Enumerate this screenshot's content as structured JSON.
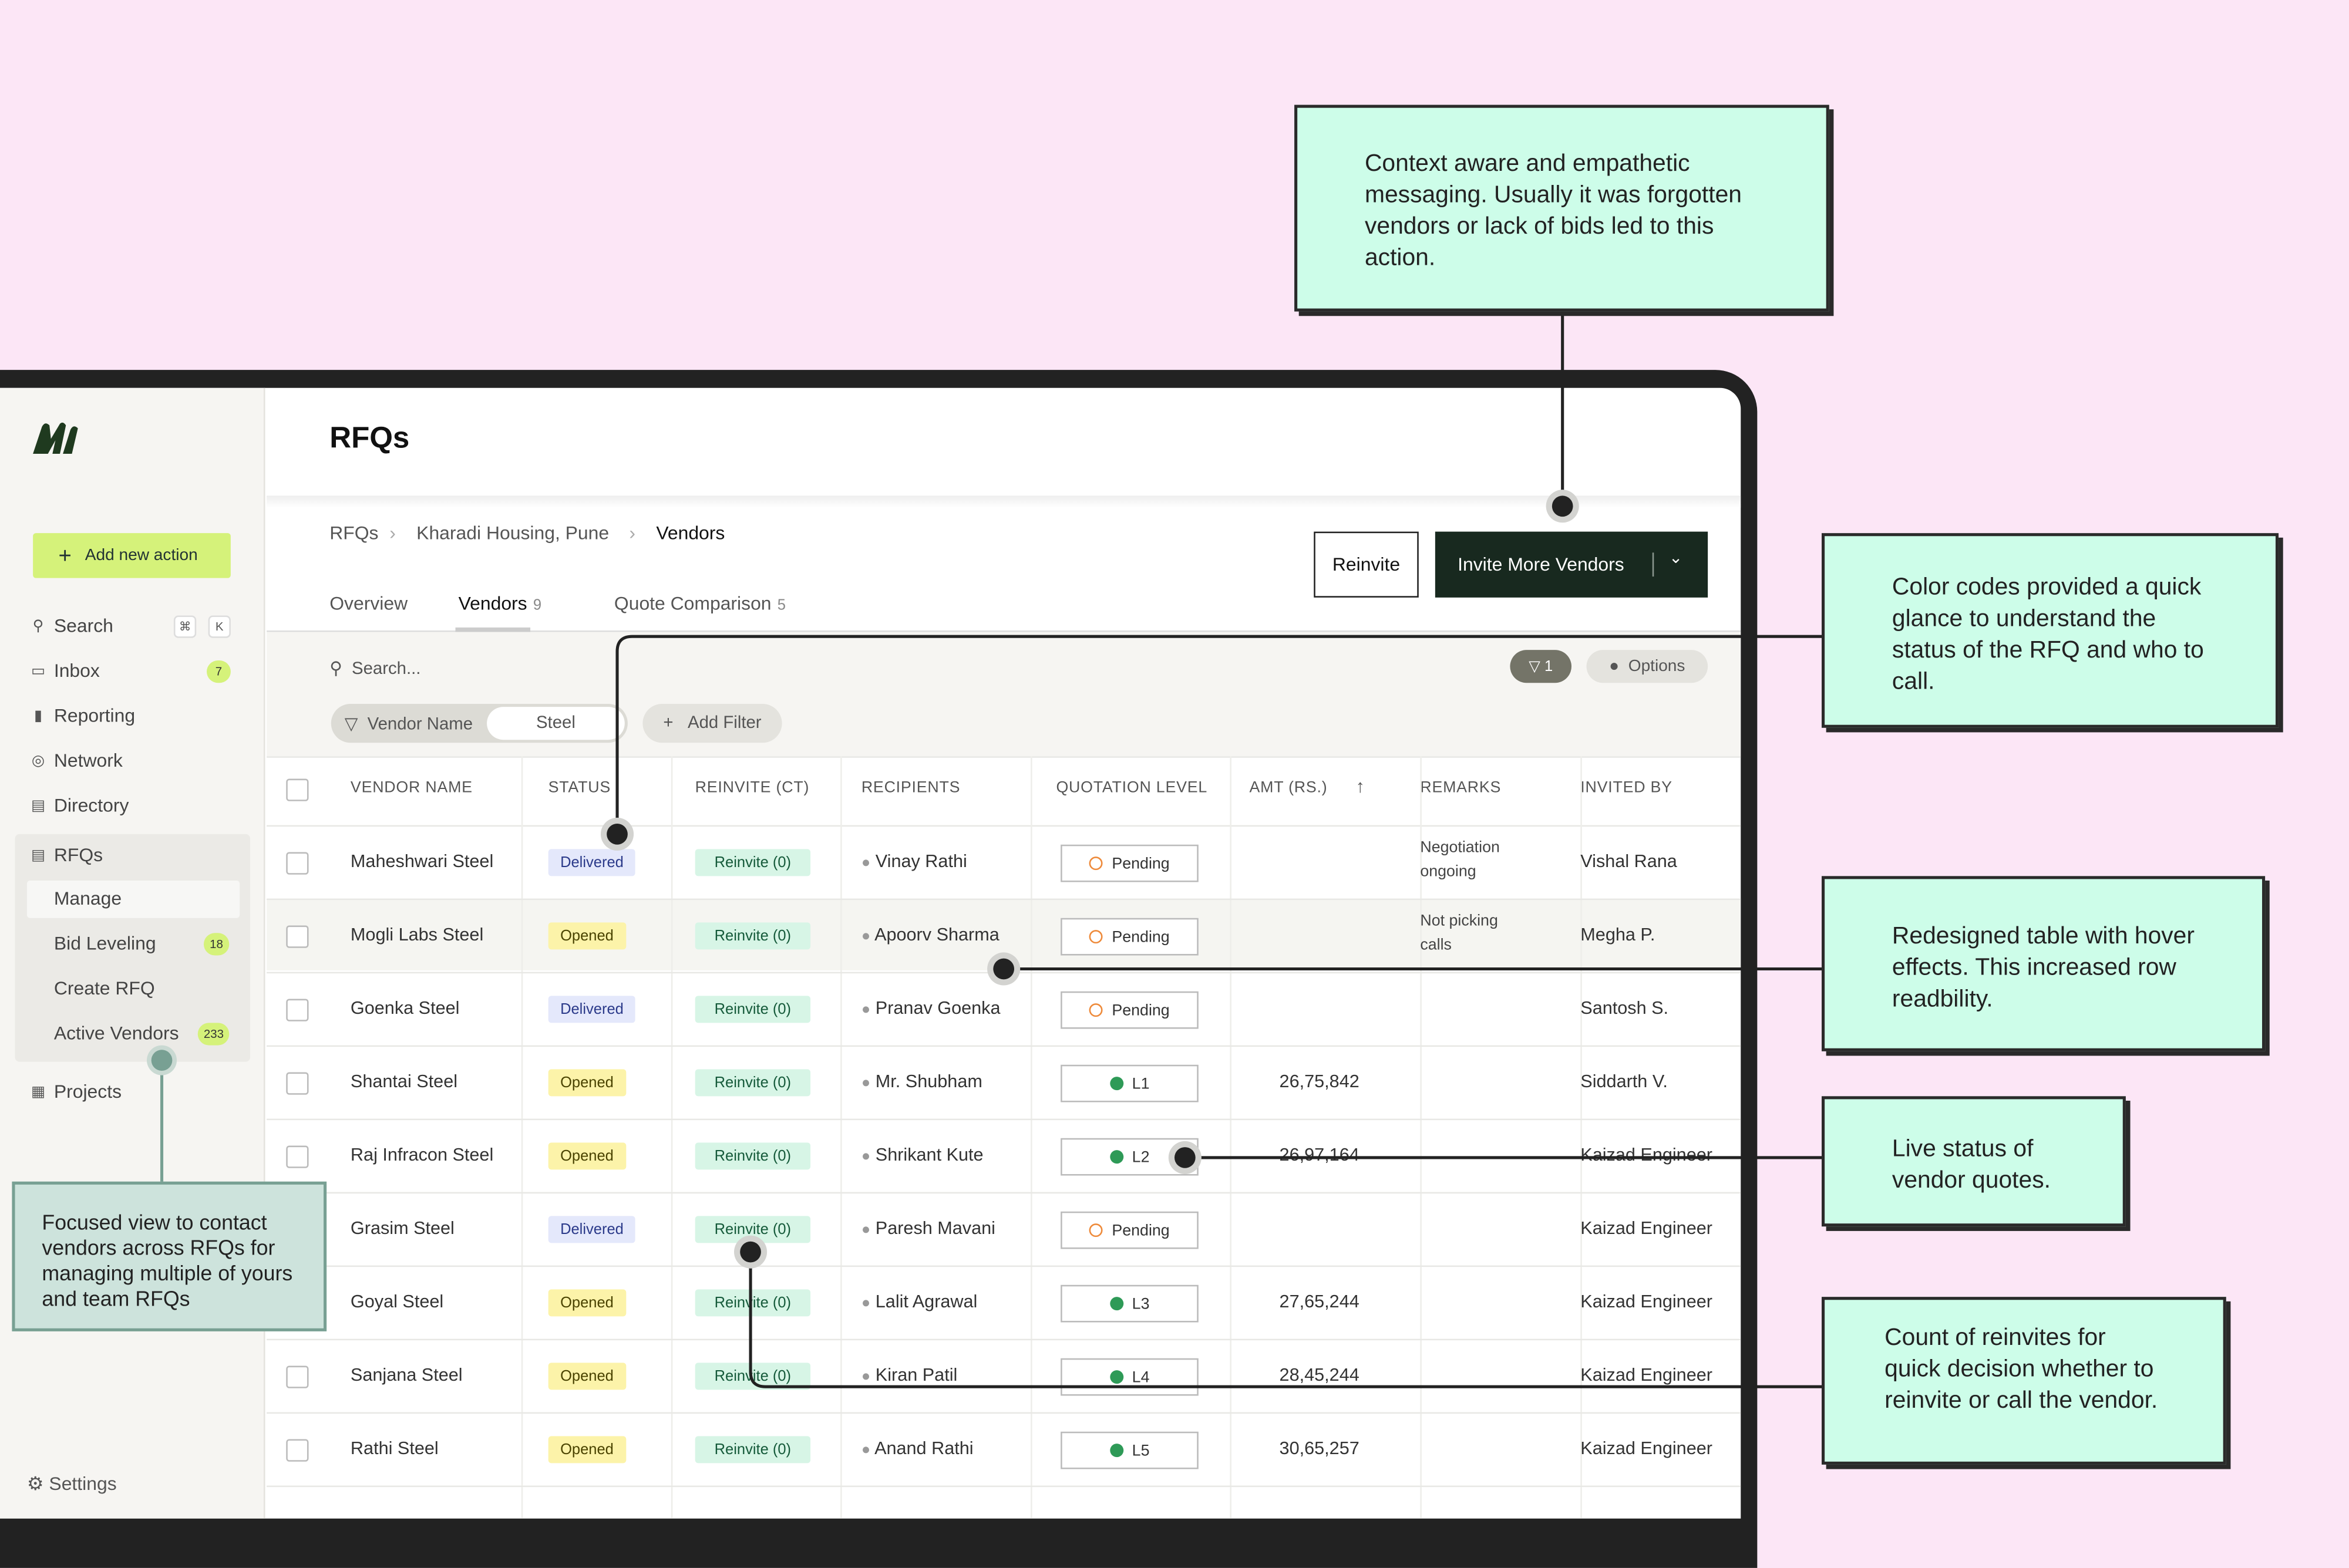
{
  "app": {
    "title": "RFQs"
  },
  "sidebar": {
    "add_action": "Add new action",
    "nav": [
      {
        "label": "Search",
        "icon": "search-icon"
      },
      {
        "label": "Inbox",
        "icon": "inbox-icon",
        "count": "7"
      },
      {
        "label": "Reporting",
        "icon": "bar-chart-icon"
      },
      {
        "label": "Network",
        "icon": "globe-icon"
      },
      {
        "label": "Directory",
        "icon": "book-icon"
      }
    ],
    "search_keys": [
      "⌘",
      "K"
    ],
    "rfqs": {
      "label": "RFQs",
      "items": [
        {
          "label": "Manage"
        },
        {
          "label": "Bid Leveling",
          "count": "18"
        },
        {
          "label": "Create RFQ"
        },
        {
          "label": "Active Vendors",
          "count": "233"
        }
      ]
    },
    "projects": "Projects",
    "settings": "Settings"
  },
  "breadcrumb": [
    "RFQs",
    "Kharadi Housing, Pune",
    "Vendors"
  ],
  "actions": {
    "reinvite": "Reinvite",
    "invite_more": "Invite More Vendors"
  },
  "tabs": [
    {
      "label": "Overview",
      "count": ""
    },
    {
      "label": "Vendors",
      "count": "9"
    },
    {
      "label": "Quote Comparison",
      "count": "5"
    }
  ],
  "toolbar": {
    "search_placeholder": "Search...",
    "filter_count": "1",
    "options": "Options",
    "filter_chip": {
      "field": "Vendor Name",
      "value": "Steel"
    },
    "add_filter": "Add Filter"
  },
  "table": {
    "columns": [
      "VENDOR NAME",
      "STATUS",
      "REINVITE (CT)",
      "RECIPIENTS",
      "QUOTATION LEVEL",
      "AMT (RS.)",
      "REMARKS",
      "INVITED BY"
    ],
    "rows": [
      {
        "vendor": "Maheshwari Steel",
        "status": "Delivered",
        "reinvite": "Reinvite (0)",
        "recipient": "Vinay Rathi",
        "quote": "Pending",
        "amount": "",
        "remarks": [
          "Negotiation",
          "ongoing"
        ],
        "invited_by": "Vishal Rana"
      },
      {
        "vendor": "Mogli Labs Steel",
        "status": "Opened",
        "reinvite": "Reinvite (0)",
        "recipient": "Apoorv Sharma",
        "quote": "Pending",
        "amount": "",
        "remarks": [
          "Not picking",
          "calls"
        ],
        "invited_by": "Megha P."
      },
      {
        "vendor": "Goenka Steel",
        "status": "Delivered",
        "reinvite": "Reinvite (0)",
        "recipient": "Pranav Goenka",
        "quote": "Pending",
        "amount": "",
        "remarks": [
          "",
          ""
        ],
        "invited_by": "Santosh S."
      },
      {
        "vendor": "Shantai Steel",
        "status": "Opened",
        "reinvite": "Reinvite (0)",
        "recipient": "Mr. Shubham",
        "quote": "L1",
        "amount": "26,75,842",
        "remarks": [
          "",
          ""
        ],
        "invited_by": "Siddarth V."
      },
      {
        "vendor": "Raj Infracon Steel",
        "status": "Opened",
        "reinvite": "Reinvite (0)",
        "recipient": "Shrikant Kute",
        "quote": "L2",
        "amount": "26,97,164",
        "remarks": [
          "",
          ""
        ],
        "invited_by": "Kaizad Engineer"
      },
      {
        "vendor": "Grasim Steel",
        "status": "Delivered",
        "reinvite": "Reinvite (0)",
        "recipient": "Paresh Mavani",
        "quote": "Pending",
        "amount": "",
        "remarks": [
          "",
          ""
        ],
        "invited_by": "Kaizad Engineer"
      },
      {
        "vendor": "Goyal Steel",
        "status": "Opened",
        "reinvite": "Reinvite (0)",
        "recipient": "Lalit Agrawal",
        "quote": "L3",
        "amount": "27,65,244",
        "remarks": [
          "",
          ""
        ],
        "invited_by": "Kaizad Engineer"
      },
      {
        "vendor": "Sanjana Steel",
        "status": "Opened",
        "reinvite": "Reinvite (0)",
        "recipient": "Kiran Patil",
        "quote": "L4",
        "amount": "28,45,244",
        "remarks": [
          "",
          ""
        ],
        "invited_by": "Kaizad Engineer"
      },
      {
        "vendor": "Rathi Steel",
        "status": "Opened",
        "reinvite": "Reinvite (0)",
        "recipient": "Anand Rathi",
        "quote": "L5",
        "amount": "30,65,257",
        "remarks": [
          "",
          ""
        ],
        "invited_by": "Kaizad Engineer"
      }
    ]
  },
  "callouts": [
    "Context aware and empathetic messaging. Usually it was forgotten vendors or lack of bids led to this action.",
    "Color codes provided a quick glance to understand the status of the RFQ and who to call.",
    "Redesigned table with hover effects. This increased row readbility.",
    "Live status of vendor quotes.",
    "Count of reinvites for quick decision whether to reinvite or call the vendor.",
    "Focused view to contact vendors across RFQs for managing multiple of yours and team RFQs"
  ],
  "colors": {
    "background": "#fce6f6",
    "callout": "#cdfde9",
    "accent_lime": "#d5f27a",
    "primary_dark": "#18291f",
    "delivered_badge": "#e4e8fb",
    "opened_badge": "#fcf3a9",
    "reinvite_badge": "#d7f5e6"
  }
}
